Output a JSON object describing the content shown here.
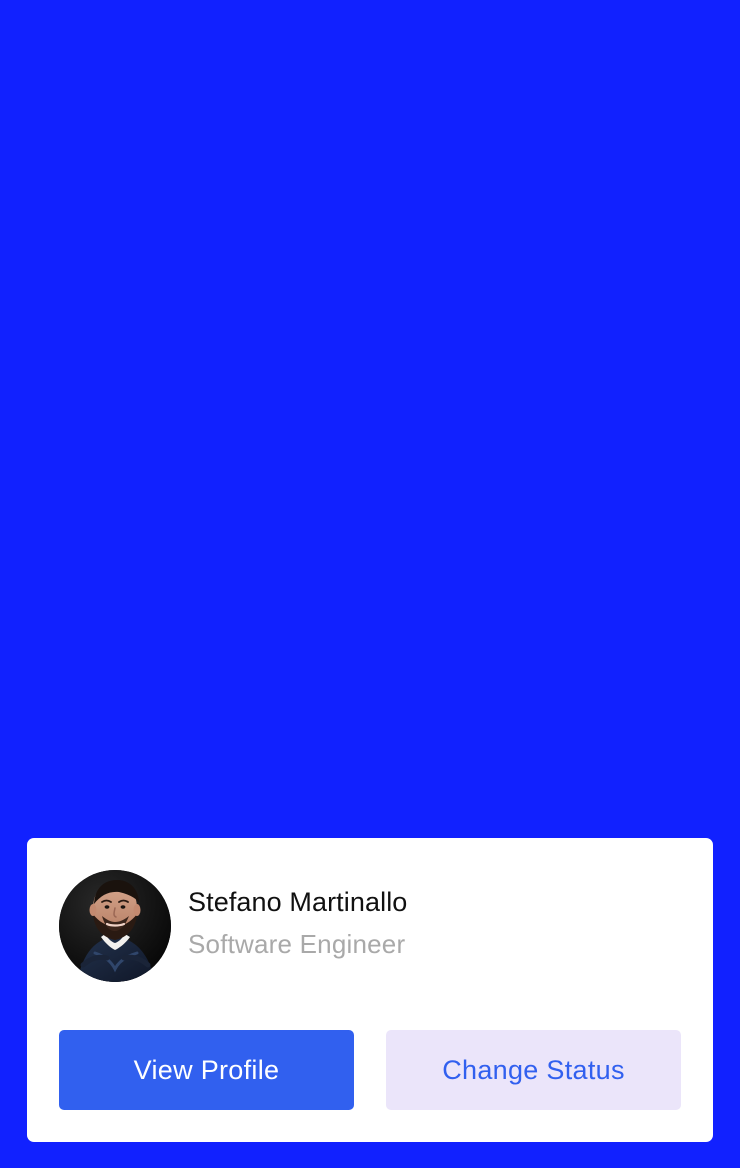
{
  "profile": {
    "name": "Stefano Martinallo",
    "role": "Software Engineer",
    "avatar_icon": "person-photo-icon"
  },
  "actions": {
    "view_profile_label": "View Profile",
    "change_status_label": "Change Status"
  },
  "colors": {
    "background": "#1121ff",
    "card": "#ffffff",
    "primary": "#3160ef",
    "secondary_background": "#ebe5fa",
    "name_text": "#111111",
    "role_text": "#a9a9a9"
  }
}
